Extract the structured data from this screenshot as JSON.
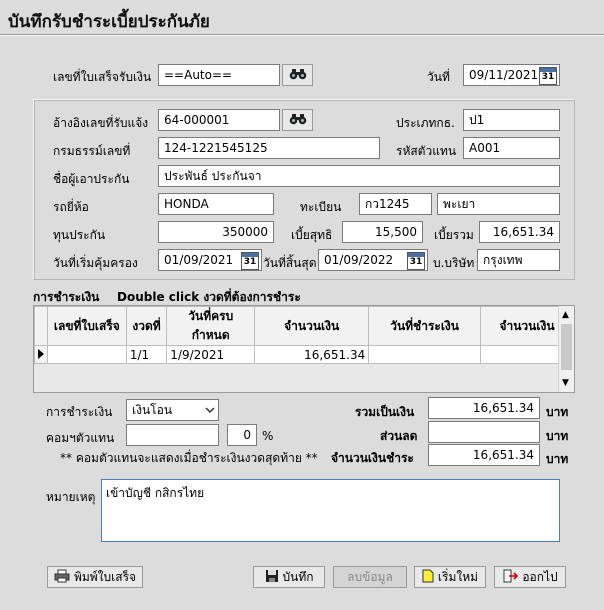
{
  "window": {
    "title": "บันทึกรับชำระเบี้ยประกันภัย"
  },
  "header": {
    "receipt_no_label": "เลขที่ใบเสร็จรับเงิน",
    "receipt_no_value": "==Auto==",
    "date_label": "วันที่",
    "date_value": "09/11/2021"
  },
  "policy": {
    "notice_ref_label": "อ้างอิงเลขที่รับแจ้ง",
    "notice_ref_value": "64-000001",
    "type_label": "ประเภทกธ.",
    "type_value": "ป1",
    "policy_no_label": "กรมธรรม์เลขที่",
    "policy_no_value": "124-1221545125",
    "agent_code_label": "รหัสตัวแทน",
    "agent_code_value": "A001",
    "insured_label": "ชื่อผู้เอาประกัน",
    "insured_value": "ประพันธ์ ประกันจา",
    "car_brand_label": "รถยี่ห้อ",
    "car_brand_value": "HONDA",
    "plate_label": "ทะเบียน",
    "plate_value": "กว1245",
    "province_value": "พะเยา",
    "sum_insured_label": "ทุนประกัน",
    "sum_insured_value": "350000",
    "net_premium_label": "เบี้ยสุทธิ",
    "net_premium_value": "15,500",
    "total_premium_label": "เบี้ยรวม",
    "total_premium_value": "16,651.34",
    "start_label": "วันที่เริ่มคุ้มครอง",
    "start_value": "01/09/2021",
    "end_label": "วันที่สิ้นสุด",
    "end_value": "01/09/2022",
    "company_label": "บ.บริษัท",
    "company_value": "กรุงเทพ"
  },
  "payment_section": {
    "title": "การชำระเงิน",
    "hint": "Double click งวดที่ต้องการชำระ",
    "columns": [
      "เลขที่ใบเสร็จ",
      "งวดที่",
      "วันที่ครบกำหนด",
      "จำนวนเงิน",
      "วันที่ชำระเงิน",
      "จำนวนเงิน"
    ],
    "rows": [
      [
        "",
        "1/1",
        "1/9/2021",
        "16,651.34",
        "",
        ""
      ]
    ]
  },
  "summary": {
    "payment_method_label": "การชำระเงิน",
    "payment_method_value": "เงินโอน",
    "commission_label": "คอมฯตัวแทน",
    "commission_amount": "",
    "commission_pct": "0",
    "pct_sign": "%",
    "note_text": "** คอมตัวแทนจะแสดงเมื่อชำระเงินงวดสุดท้าย **",
    "total_label": "รวมเป็นเงิน",
    "total_value": "16,651.34",
    "discount_label": "ส่วนลด",
    "discount_value": "",
    "paid_label": "จำนวนเงินชำระ",
    "paid_value": "16,651.34",
    "currency": "บาท"
  },
  "remark": {
    "label": "หมายเหตุ",
    "value": "เข้าบัญชี กสิกรไทย"
  },
  "buttons": {
    "print": "พิมพ์ใบเสร็จ",
    "save": "บันทึก",
    "delete": "ลบข้อมูล",
    "new": "เริ่มใหม่",
    "exit": "ออกไป"
  }
}
